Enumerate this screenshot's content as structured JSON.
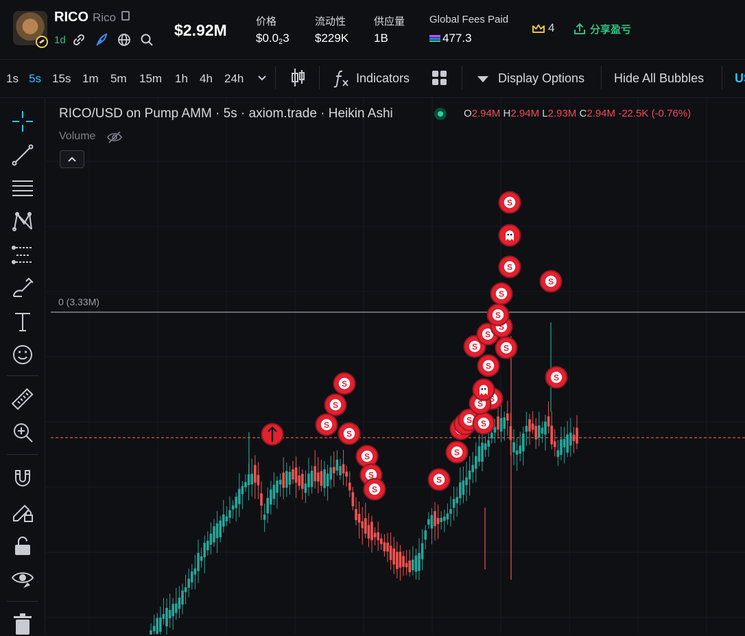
{
  "token": {
    "symbol": "RICO",
    "name": "Rico",
    "age": "1d",
    "market_cap": "$2.92M"
  },
  "metrics": [
    {
      "label": "价格",
      "value_main": "$0.0",
      "value_sub": "2",
      "value_tail": "3"
    },
    {
      "label": "流动性",
      "value": "$229K"
    },
    {
      "label": "供应量",
      "value": "1B"
    },
    {
      "label": "Global Fees Paid",
      "value": "477.3"
    }
  ],
  "crown_count": "4",
  "pnl_label": "分享盈亏",
  "timeframes": [
    "1s",
    "5s",
    "15s",
    "1m",
    "5m",
    "15m",
    "1h",
    "4h",
    "24h"
  ],
  "active_timeframe": "5s",
  "toolbar": {
    "indicators_label": "Indicators",
    "display_options_label": "Display Options",
    "hide_bubbles_label": "Hide All Bubbles",
    "overflow_label": "US"
  },
  "chart": {
    "legend": "RICO/USD on Pump AMM · 5s · axiom.trade · Heikin Ashi",
    "ohlc": {
      "o": "2.94M",
      "h": "2.94M",
      "l": "2.93M",
      "c": "2.94M",
      "change": "-22.5K (-0.76%)"
    },
    "volume_label": "Volume",
    "level_label": "0 (3.33M)"
  },
  "chart_data": {
    "type": "candlestick",
    "style": "Heikin Ashi",
    "pair": "RICO/USD",
    "interval": "5s",
    "unit": "USD market cap",
    "price_line": "2.94M",
    "level_line": "3.33M",
    "trade_markers": {
      "sell_label": "S"
    }
  },
  "colors": {
    "up": "#26a69a",
    "down": "#ef5350",
    "accent": "#2ec3ff",
    "positive": "#2ec27e",
    "marker": "#e5202f"
  }
}
